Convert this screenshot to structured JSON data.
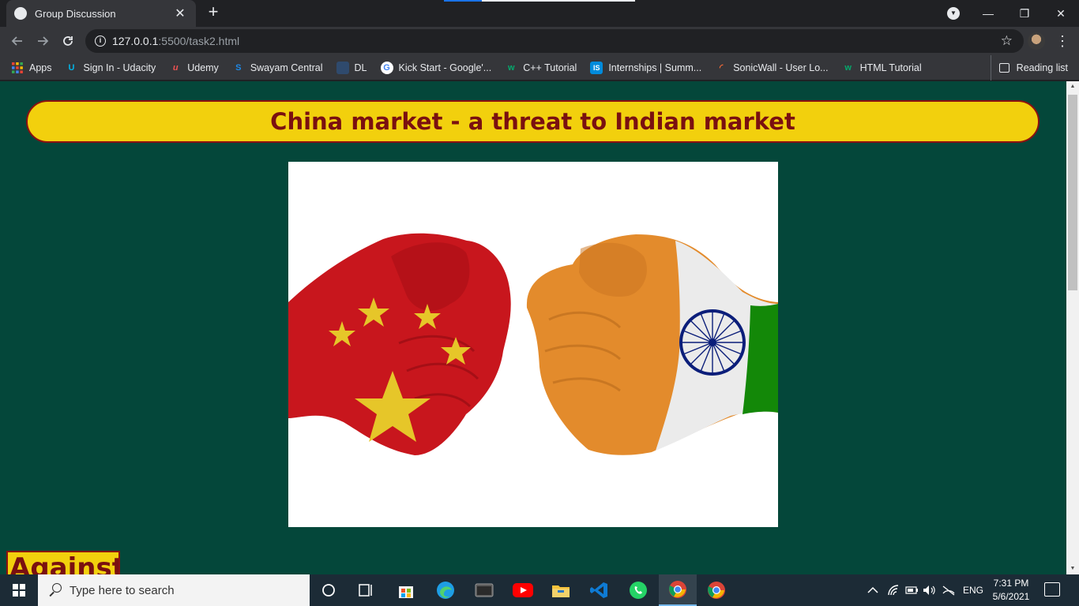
{
  "browser": {
    "tab_title": "Group Discussion",
    "tab_close": "✕",
    "new_tab": "+",
    "url_host": "127.0.0.1",
    "url_path": ":5500/task2.html",
    "window_controls": {
      "minimize": "—",
      "restore": "❐",
      "close": "✕"
    }
  },
  "bookmarks": [
    {
      "label": "Apps",
      "icon": "apps-grid-icon",
      "color": "#ea4335"
    },
    {
      "label": "Sign In - Udacity",
      "icon": "udacity-icon",
      "color": "#02b3e4"
    },
    {
      "label": "Udemy",
      "icon": "udemy-icon",
      "color": "#ec5252"
    },
    {
      "label": "Swayam Central",
      "icon": "swayam-icon",
      "color": "#1e88e5"
    },
    {
      "label": "DL",
      "icon": "dl-icon",
      "color": "#4a6fa5"
    },
    {
      "label": "Kick Start - Google'...",
      "icon": "google-icon",
      "color": "#ffffff"
    },
    {
      "label": "C++ Tutorial",
      "icon": "w3schools-icon",
      "color": "#04aa6d"
    },
    {
      "label": "Internships | Summ...",
      "icon": "internshala-icon",
      "color": "#008bdc"
    },
    {
      "label": "SonicWall - User Lo...",
      "icon": "sonicwall-icon",
      "color": "#ff6c37"
    },
    {
      "label": "HTML Tutorial",
      "icon": "w3schools-icon",
      "color": "#04aa6d"
    }
  ],
  "reading_list": "Reading list",
  "page": {
    "heading": "China market - a threat to Indian market",
    "section_label": "Against"
  },
  "taskbar": {
    "search_placeholder": "Type here to search",
    "language": "ENG",
    "time": "7:31 PM",
    "date": "5/6/2021"
  },
  "colors": {
    "page_bg": "#04473a",
    "heading_bg": "#f2d00d",
    "heading_text": "#7a1010",
    "china_red": "#c8161d",
    "india_saffron": "#e38b2c",
    "india_green": "#138808"
  }
}
